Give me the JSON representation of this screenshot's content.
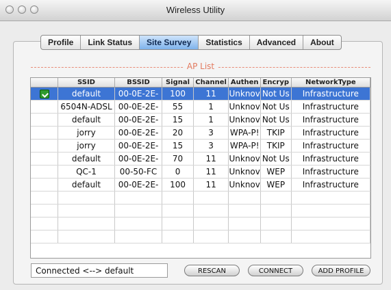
{
  "window": {
    "title": "Wireless Utility"
  },
  "tabs": [
    {
      "label": "Profile"
    },
    {
      "label": "Link Status"
    },
    {
      "label": "Site Survey",
      "active": true
    },
    {
      "label": "Statistics"
    },
    {
      "label": "Advanced"
    },
    {
      "label": "About"
    }
  ],
  "ap_list": {
    "heading": "AP List",
    "columns": [
      "",
      "SSID",
      "BSSID",
      "Signal",
      "Channel",
      "Authen",
      "Encryp",
      "NetworkType"
    ],
    "rows": [
      {
        "icon": "connected-signal-icon",
        "ssid": "default",
        "bssid": "00-0E-2E-",
        "signal": "100",
        "channel": "11",
        "authen": "Unknov",
        "encryp": "Not Us",
        "network_type": "Infrastructure",
        "selected": true
      },
      {
        "icon": "",
        "ssid": "6504N-ADSL",
        "bssid": "00-0E-2E-",
        "signal": "55",
        "channel": "1",
        "authen": "Unknov",
        "encryp": "Not Us",
        "network_type": "Infrastructure"
      },
      {
        "icon": "",
        "ssid": "default",
        "bssid": "00-0E-2E-",
        "signal": "15",
        "channel": "1",
        "authen": "Unknov",
        "encryp": "Not Us",
        "network_type": "Infrastructure"
      },
      {
        "icon": "",
        "ssid": "jorry",
        "bssid": "00-0E-2E-",
        "signal": "20",
        "channel": "3",
        "authen": "WPA-P!",
        "encryp": "TKIP",
        "network_type": "Infrastructure"
      },
      {
        "icon": "",
        "ssid": "jorry",
        "bssid": "00-0E-2E-",
        "signal": "15",
        "channel": "3",
        "authen": "WPA-P!",
        "encryp": "TKIP",
        "network_type": "Infrastructure"
      },
      {
        "icon": "",
        "ssid": "default",
        "bssid": "00-0E-2E-",
        "signal": "70",
        "channel": "11",
        "authen": "Unknov",
        "encryp": "Not Us",
        "network_type": "Infrastructure"
      },
      {
        "icon": "",
        "ssid": "QC-1",
        "bssid": "00-50-FC",
        "signal": "0",
        "channel": "11",
        "authen": "Unknov",
        "encryp": "WEP",
        "network_type": "Infrastructure"
      },
      {
        "icon": "",
        "ssid": "default",
        "bssid": "00-0E-2E-",
        "signal": "100",
        "channel": "11",
        "authen": "Unknov",
        "encryp": "WEP",
        "network_type": "Infrastructure"
      }
    ],
    "empty_rows": 4
  },
  "status": {
    "text": "Connected <--> default"
  },
  "buttons": {
    "rescan": "RESCAN",
    "connect": "CONNECT",
    "add_profile": "ADD PROFILE"
  },
  "colors": {
    "selection": "#3d75d4",
    "active_tab": "#7fb3ec",
    "ap_list_label": "#e27a5f"
  }
}
